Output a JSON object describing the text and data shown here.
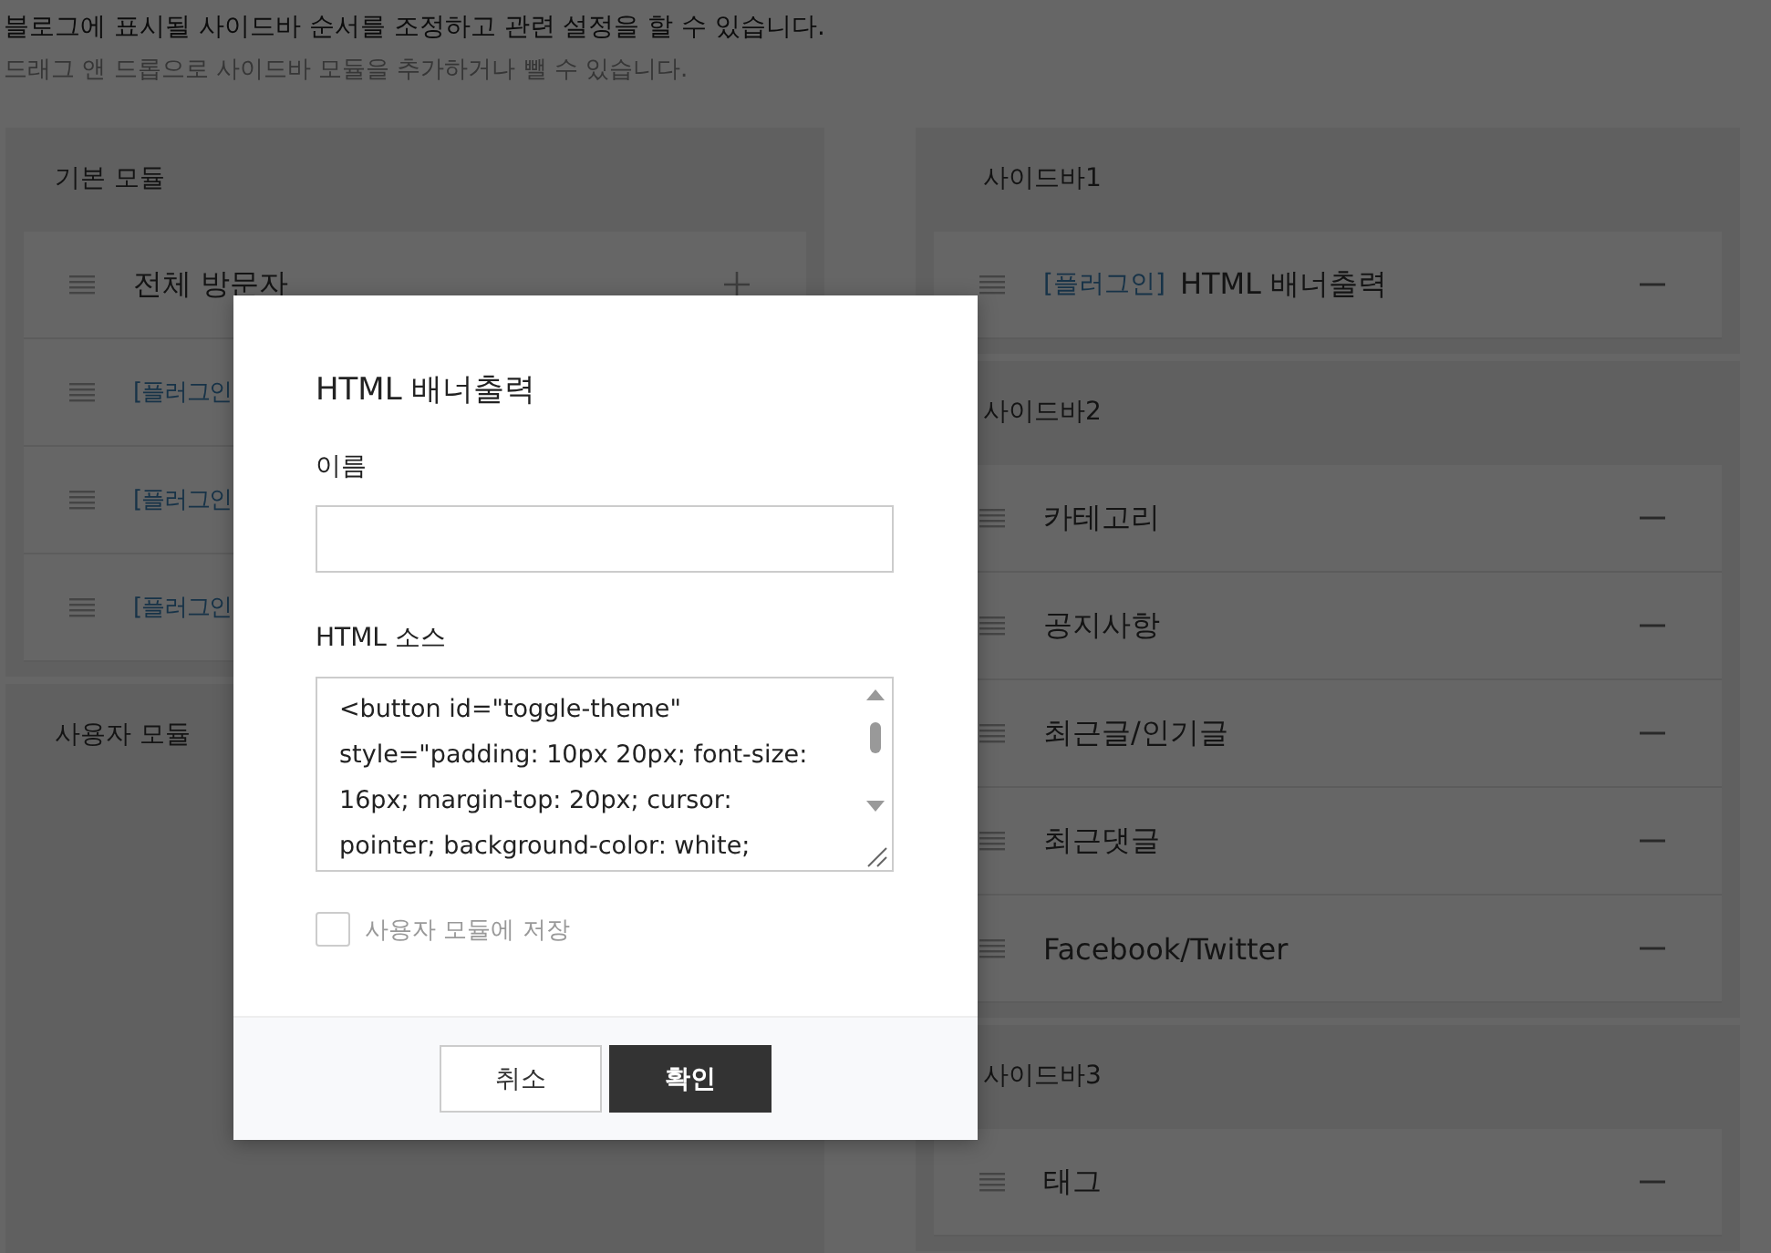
{
  "intro": {
    "title": "블로그에 표시될 사이드바 순서를 조정하고 관련 설정을 할 수 있습니다.",
    "hint": "드래그 앤 드롭으로 사이드바 모듈을 추가하거나 뺄 수 있습니다."
  },
  "left_panels": [
    {
      "title": "기본 모듈",
      "items": [
        {
          "label": "전체 방문자",
          "kind": "plain"
        },
        {
          "label": "[플러그인",
          "kind": "plugin"
        },
        {
          "label": "[플러그인",
          "kind": "plugin"
        },
        {
          "label": "[플러그인",
          "kind": "plugin"
        }
      ]
    },
    {
      "title": "사용자 모듈"
    }
  ],
  "right_panels": [
    {
      "title": "사이드바1",
      "items": [
        {
          "prefix": "[플러그인]",
          "label": "HTML 배너출력"
        }
      ]
    },
    {
      "title": "사이드바2",
      "items": [
        {
          "label": "카테고리"
        },
        {
          "label": "공지사항"
        },
        {
          "label": "최근글/인기글"
        },
        {
          "label": "최근댓글"
        },
        {
          "label": "Facebook/Twitter"
        }
      ]
    },
    {
      "title": "사이드바3",
      "items": [
        {
          "label": "태그"
        }
      ]
    }
  ],
  "dialog": {
    "title": "HTML 배너출력",
    "name_label": "이름",
    "source_label": "HTML 소스",
    "source_value": "<button id=\"toggle-theme\" style=\"padding: 10px 20px; font-size: 16px; margin-top: 20px; cursor: pointer; background-color: white;",
    "save_label": "사용자 모듈에 저장",
    "save_checked": false,
    "buttons": [
      {
        "label": "취소",
        "kind": "secondary"
      },
      {
        "label": "확인",
        "kind": "primary"
      }
    ]
  }
}
